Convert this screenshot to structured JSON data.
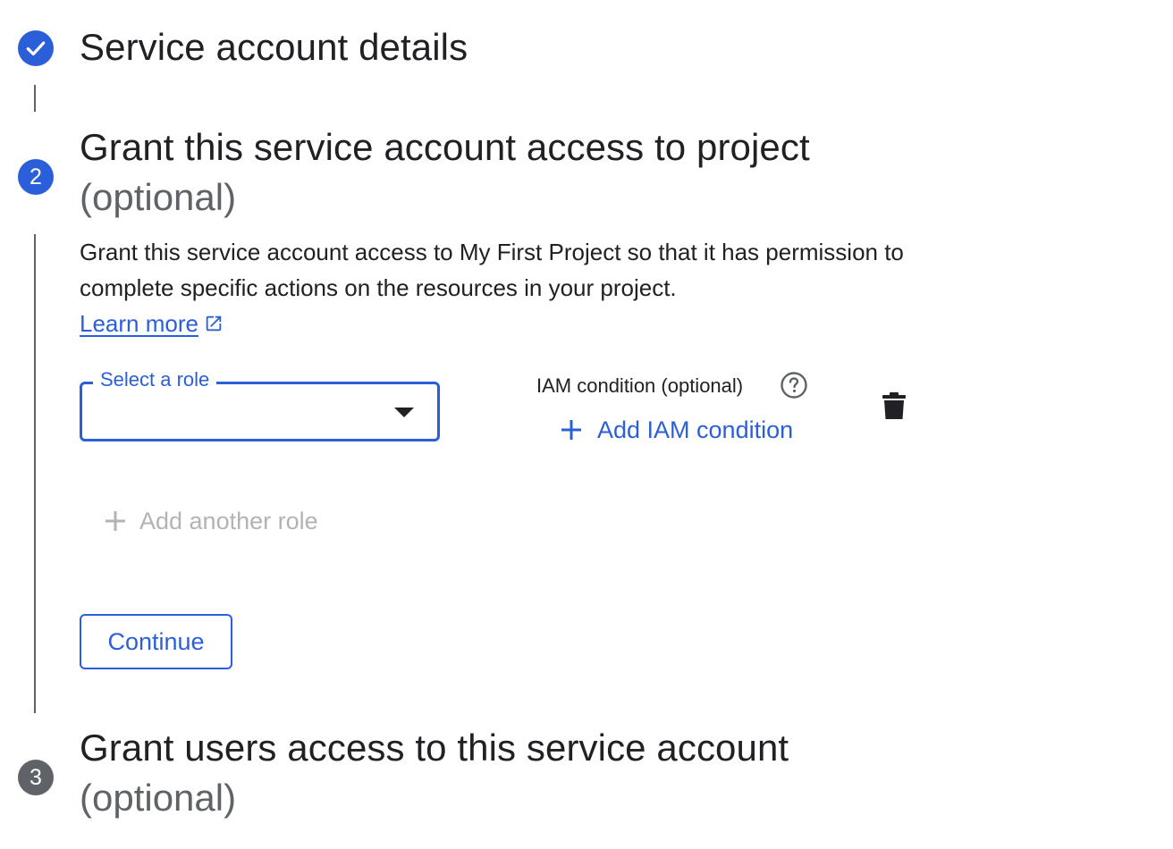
{
  "steps": [
    {
      "number": "",
      "status": "done",
      "title": "Service account details",
      "optional": ""
    },
    {
      "number": "2",
      "status": "active",
      "title": "Grant this service account access to project",
      "optional": "(optional)"
    },
    {
      "number": "3",
      "status": "pending",
      "title": "Grant users access to this service account",
      "optional": "(optional)"
    }
  ],
  "step2": {
    "description": "Grant this service account access to My First Project so that it has permission to complete specific actions on the resources in your project.",
    "learn_more": "Learn more",
    "role_select": {
      "label": "Select a role",
      "value": ""
    },
    "iam_condition_label": "IAM condition (optional)",
    "add_iam_condition": "Add IAM condition",
    "add_another_role": "Add another role",
    "continue_label": "Continue"
  },
  "icons": {
    "step1": "check-icon",
    "help": "help-circle-icon",
    "delete": "trash-icon",
    "external": "external-link-icon",
    "add": "plus-icon",
    "dropdown": "dropdown-arrow-icon"
  },
  "colors": {
    "accent": "#2b5fd9",
    "pending": "#5f6368",
    "disabled": "#b3b3b3",
    "text": "#202124"
  }
}
